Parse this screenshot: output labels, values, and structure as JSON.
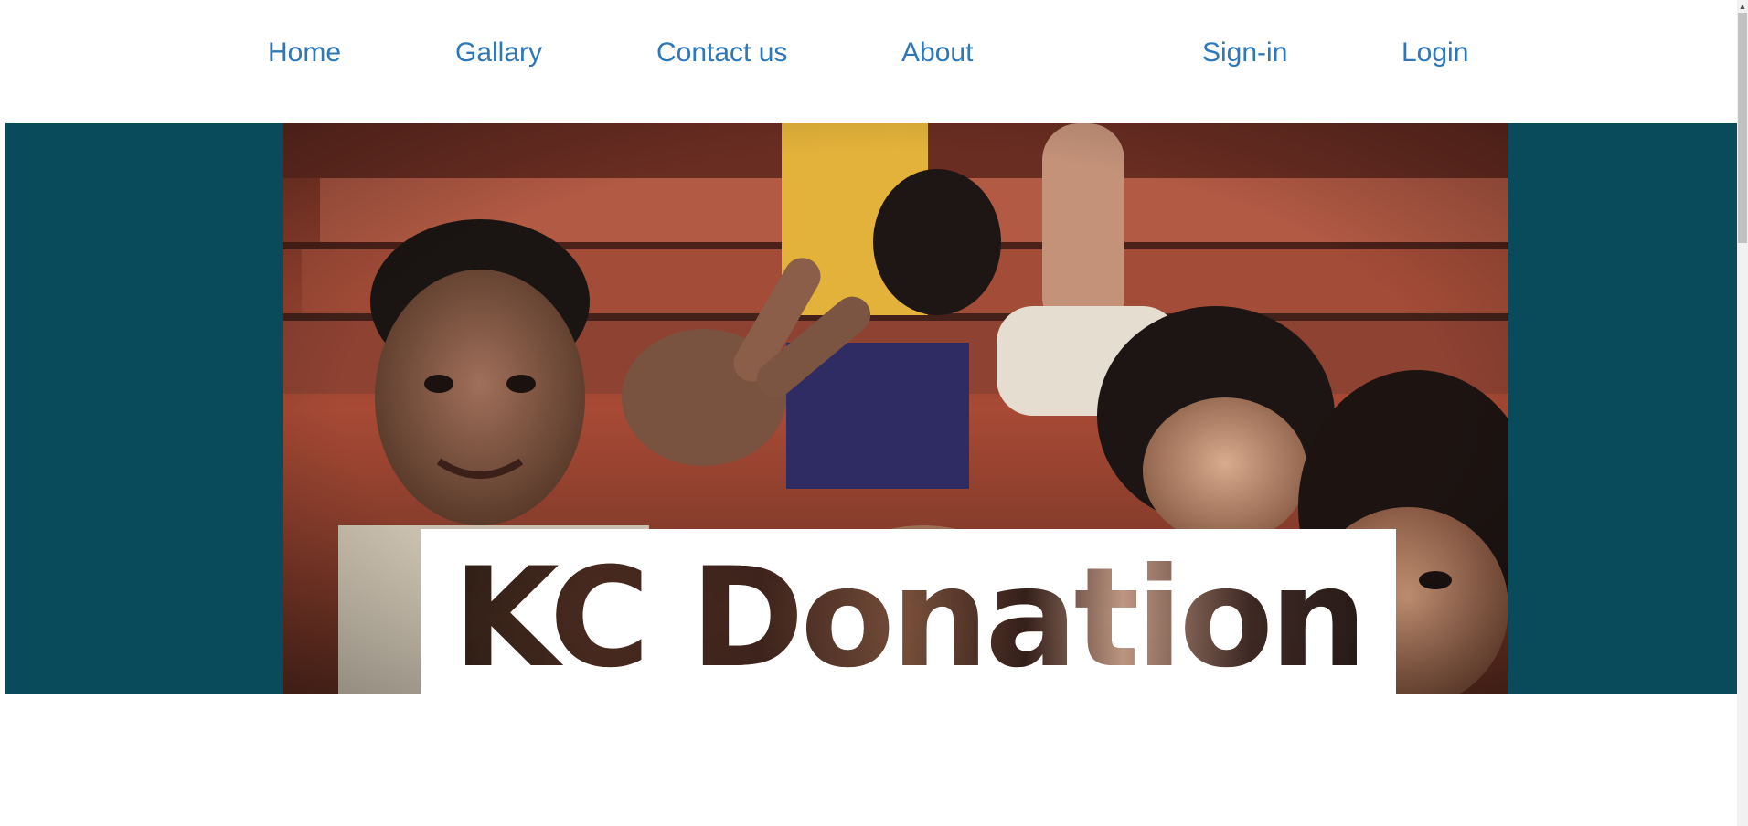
{
  "nav": {
    "home": "Home",
    "gallery": "Gallary",
    "contact": "Contact us",
    "about": "About",
    "signin": "Sign-in",
    "login": "Login"
  },
  "hero": {
    "title": "KC Donation",
    "photo_description": "children smiling and making peace signs on red steps"
  },
  "colors": {
    "nav_link": "#2e78b8",
    "hero_background": "#0a4b5b",
    "banner_background": "#ffffff"
  },
  "icons": {
    "scroll_up": "scroll-up-arrow-icon"
  }
}
